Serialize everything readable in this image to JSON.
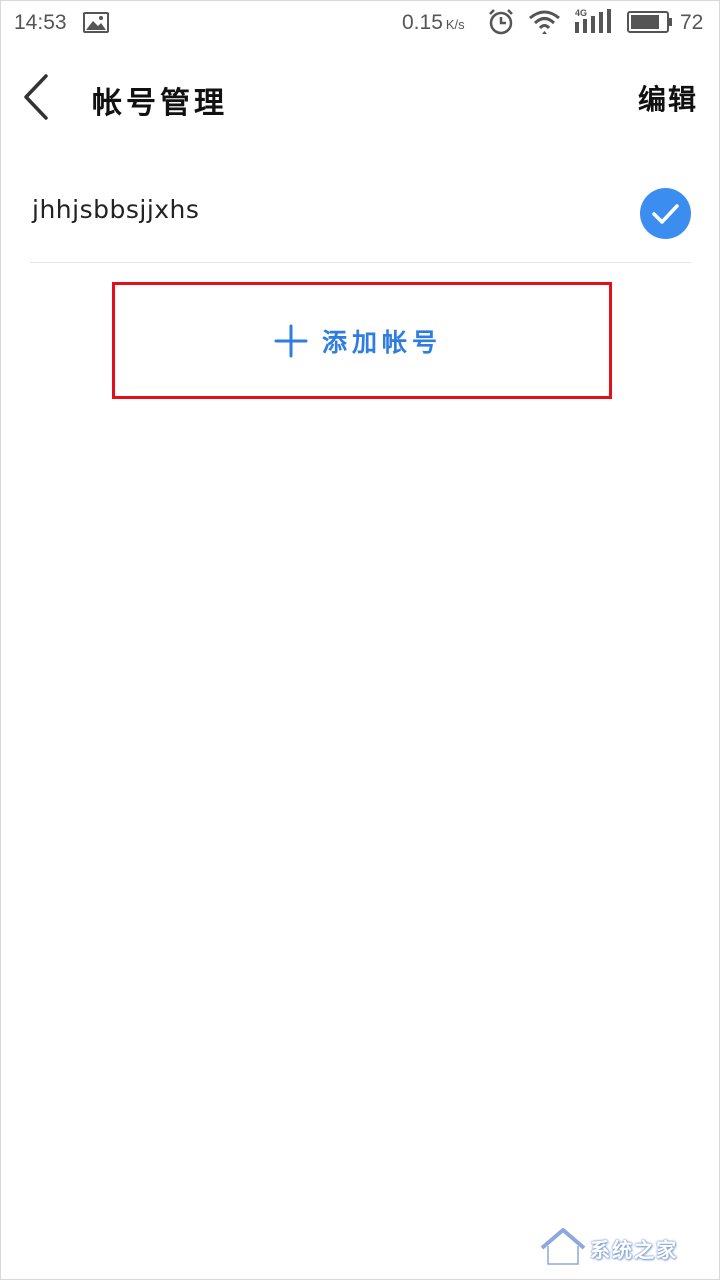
{
  "status_bar": {
    "time": "14:53",
    "speed": "0.15",
    "speed_unit": "K/s",
    "network_tag": "4G",
    "battery_percent": "72",
    "icons": [
      "image-icon",
      "alarm-icon",
      "wifi-icon",
      "signal-icon",
      "battery-icon"
    ]
  },
  "nav": {
    "title": "帐号管理",
    "edit_label": "编辑",
    "back_icon": "chevron-left-icon"
  },
  "accounts": [
    {
      "name": "jhhjsbbsjjxhs",
      "selected": true
    }
  ],
  "add_account": {
    "label": "添加帐号",
    "icon": "plus-icon"
  },
  "watermark": {
    "text": "系统之家"
  },
  "colors": {
    "accent": "#2f7de1",
    "check_fill": "#3b8ef0",
    "highlight_border": "#e3101a"
  }
}
